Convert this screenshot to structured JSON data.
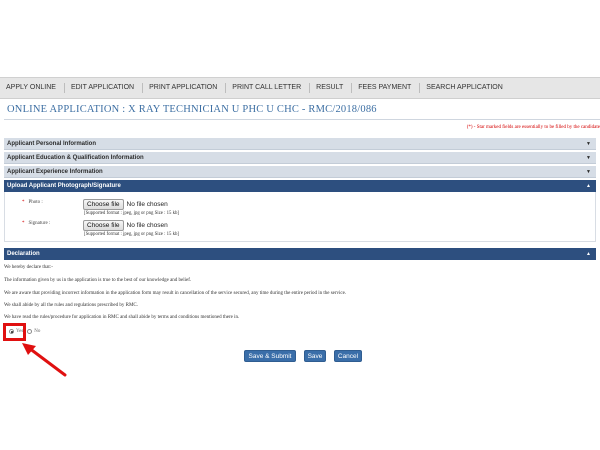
{
  "nav": {
    "items": [
      "APPLY ONLINE",
      "EDIT APPLICATION",
      "PRINT APPLICATION",
      "PRINT CALL LETTER",
      "RESULT",
      "FEES PAYMENT",
      "SEARCH APPLICATION"
    ]
  },
  "page": {
    "title": "ONLINE APPLICATION : X RAY TECHNICIAN U PHC U CHC - RMC/2018/086",
    "star_note": "(*) - Star marked fields are essentially to be filled by the candidate"
  },
  "sections": {
    "personal": "Applicant Personal Information",
    "education": "Applicant Education & Qualification Information",
    "experience": "Applicant Experience Information",
    "upload": "Upload Applicant Photograph/Signature",
    "declaration": "Declaration"
  },
  "upload": {
    "photo_label": "Photo :",
    "signature_label": "Signature :",
    "choose_file": "Choose file",
    "no_file": "No file chosen",
    "format_note": "[Supported format : jpeg, jpg or png Size : 15 kb]",
    "star": "*"
  },
  "declaration": {
    "intro": "We hereby declare that:-",
    "line1": "The information given by us in the application is true to the best of our knowledge and belief.",
    "line2": "We are aware that providing incorrect information in the application form may result in cancellation of the service secured, any time during the entire period in the service.",
    "line3": "We shall abide by all the rules and regulations prescribed by RMC.",
    "line4": "We have read the rules/procedure for application in RMC and shall abide by terms and conditions mentioned there in.",
    "yes": "Yes",
    "no": "No",
    "selected": "Yes"
  },
  "buttons": {
    "save_submit": "Save & Submit",
    "save": "Save",
    "cancel": "Cancel"
  },
  "icons": {
    "collapsed": "chevron-down-icon",
    "expanded": "chevron-up-icon"
  },
  "colors": {
    "title": "#3d6fa3",
    "section_dark": "#2d4f7f",
    "section_light": "#d6dde6",
    "button": "#3a6ea9",
    "annotation": "#e01010"
  }
}
